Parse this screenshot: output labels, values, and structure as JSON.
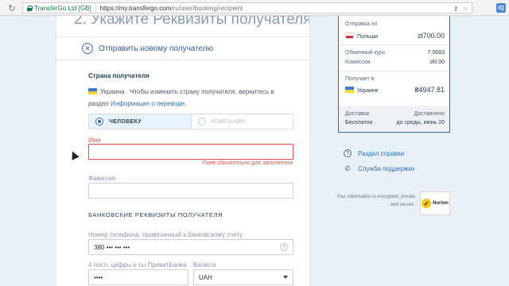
{
  "browser": {
    "site_identity": "TransferGo Ltd [GB]",
    "url_host": "https://my.transfergo.com",
    "url_path": "/ru/user/booking/recipient"
  },
  "form": {
    "step_title": "2. Укажите Реквизиты получателя",
    "new_recipient_label": "Отправить новому получателю",
    "country_label": "Страна получателя",
    "country_value": "Украина",
    "country_hint": "Чтобы изменить страну получателя, вернитесь в раздел",
    "country_link": "Информация о переводе",
    "country_hint_end": ".",
    "type_person": "ЧЕЛОВЕКУ",
    "type_company": "КОМПАНИИ",
    "first_name_label": "Имя",
    "first_name_value": "",
    "required_error": "Поле обязательно для заполнения",
    "last_name_label": "Фамилия",
    "last_name_value": "",
    "bank_section": "БАНКОВСКИЕ РЕКВИЗИТЫ ПОЛУЧАТЕЛЯ",
    "phone_label": "Номер телефона, привязанный к банковскому счету",
    "phone_value": "380 ••• ••• •••",
    "phone_help": "?",
    "card_label": "4 посл. цифры к-ты ПриватБанка",
    "card_value": "••••",
    "currency_label": "Валюта",
    "currency_value": "UAH"
  },
  "summary": {
    "send_from_label": "Отправка из",
    "send_from_country": "Польши",
    "send_amount": "zł700.00",
    "rate_label": "Обменный курс",
    "rate_value": "7.0683",
    "fee_label": "Комиссия",
    "fee_value": "zł0.00",
    "receive_label": "Получает в",
    "receive_country": "Украине",
    "receive_amount": "₴4947.81",
    "delivery_label": "Доставка",
    "delivery_value": "Бесплатно",
    "delivered_label": "Доставлено",
    "delivered_value": "до среды, июнь 20"
  },
  "sidebar": {
    "help_link": "Раздел справки",
    "support_link": "Служба поддержки",
    "secure_note": "Your information is encrypted, private and secure.",
    "norton_badge": "Norton"
  },
  "colors": {
    "accent": "#2e6fb3",
    "error": "#d9534f",
    "page_bg": "#e9f1f8"
  }
}
